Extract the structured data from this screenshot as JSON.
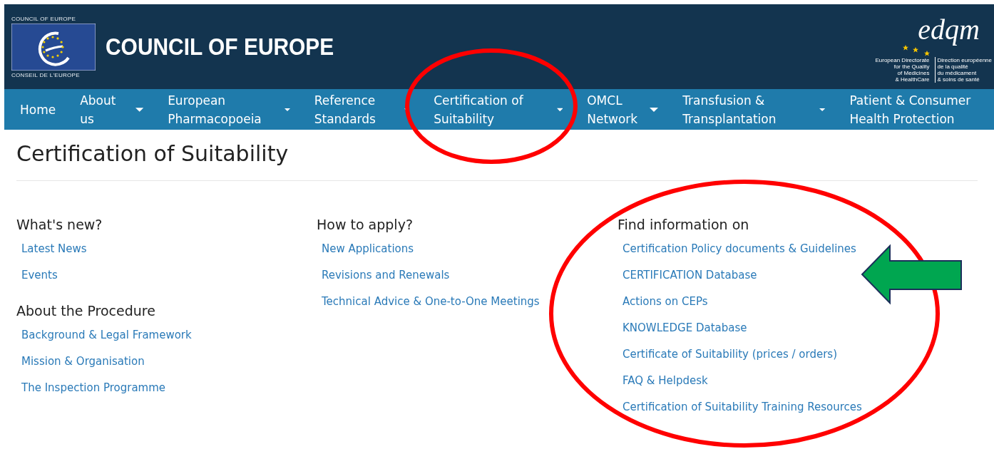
{
  "header": {
    "emblem_top": "COUNCIL OF EUROPE",
    "emblem_bottom": "CONSEIL DE L'EUROPE",
    "title": "COUNCIL OF EUROPE",
    "edqm": {
      "logo": "edqm",
      "english": [
        "European Directorate",
        "for the Quality",
        "of Medicines",
        "& HealthCare"
      ],
      "french": [
        "Direction européenne",
        "de la qualité",
        "du médicament",
        "& soins de santé"
      ]
    }
  },
  "nav": [
    {
      "label": "Home",
      "dropdown": false
    },
    {
      "label": "About us",
      "dropdown": true
    },
    {
      "label": "European Pharmacopoeia",
      "dropdown": true
    },
    {
      "label": "Reference Standards",
      "dropdown": true
    },
    {
      "label": "Certification of Suitability",
      "dropdown": true
    },
    {
      "label": "OMCL Network",
      "dropdown": true
    },
    {
      "label": "Transfusion & Transplantation",
      "dropdown": true
    },
    {
      "label": "Patient & Consumer Health Protection",
      "dropdown": false
    }
  ],
  "page_title": "Certification of Suitability",
  "columns": [
    [
      {
        "heading": "What's new?",
        "links": [
          "Latest News",
          "Events"
        ]
      },
      {
        "heading": "About the Procedure",
        "links": [
          "Background & Legal Framework",
          "Mission & Organisation",
          "The Inspection Programme"
        ]
      }
    ],
    [
      {
        "heading": "How to apply?",
        "links": [
          "New Applications",
          "Revisions and Renewals",
          "Technical Advice & One-to-One Meetings"
        ]
      }
    ],
    [
      {
        "heading": "Find information on",
        "links": [
          "Certification Policy documents & Guidelines",
          "CERTIFICATION Database",
          "Actions on CEPs",
          "KNOWLEDGE Database",
          "Certificate of Suitability (prices / orders)",
          "FAQ & Helpdesk",
          "Certification of Suitability Training Resources"
        ]
      }
    ]
  ],
  "annotations": [
    {
      "kind": "ellipse"
    },
    {
      "kind": "ellipse"
    },
    {
      "kind": "arrow"
    }
  ]
}
